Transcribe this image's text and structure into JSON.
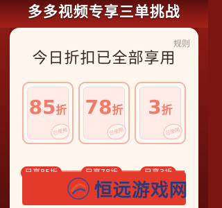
{
  "header": {
    "headline": "多多视频专享三单挑战"
  },
  "panel": {
    "rules_label": "规则",
    "title": "今日折扣已全部享用"
  },
  "cards": [
    {
      "value": "85",
      "unit": "折",
      "stamp": "已使用",
      "pill": "已享85折"
    },
    {
      "value": "78",
      "unit": "折",
      "stamp": "已使用",
      "pill": "已享78折"
    },
    {
      "value": "3",
      "unit": "折",
      "stamp": "已使用",
      "pill": "已享3折"
    }
  ],
  "watermark": {
    "text": "恒远游戏网"
  },
  "colors": {
    "accent_red": "#e43a2b",
    "card_border": "#f5b3a6",
    "discount_text": "#f07b6a",
    "panel_bg": "#fff6ee"
  }
}
